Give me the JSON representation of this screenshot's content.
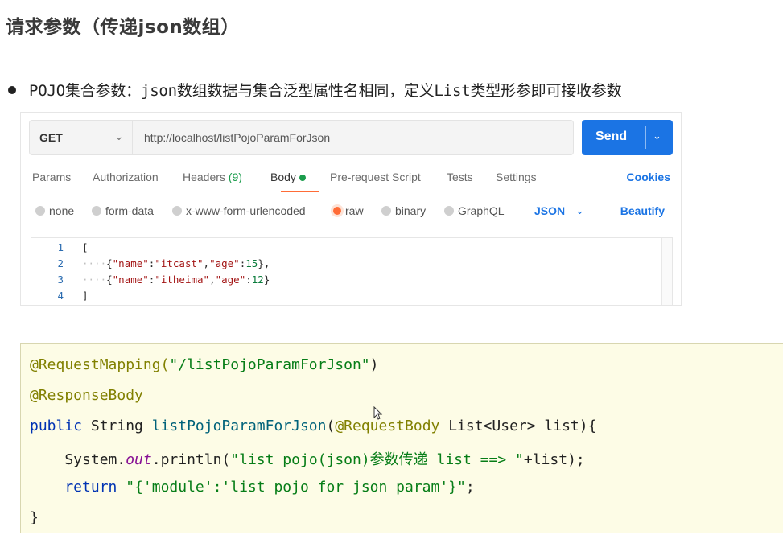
{
  "page": {
    "title": "请求参数（传递json数组）",
    "bullet": "POJO集合参数：json数组数据与集合泛型属性名相同，定义List类型形参即可接收参数"
  },
  "postman": {
    "method": "GET",
    "url": "http://localhost/listPojoParamForJson",
    "send_label": "Send",
    "tabs": [
      {
        "label": "Params"
      },
      {
        "label": "Authorization"
      },
      {
        "label": "Headers",
        "count": "(9)"
      },
      {
        "label": "Body"
      },
      {
        "label": "Pre-request Script"
      },
      {
        "label": "Tests"
      },
      {
        "label": "Settings"
      }
    ],
    "cookies_label": "Cookies",
    "body_types": [
      "none",
      "form-data",
      "x-www-form-urlencoded",
      "raw",
      "binary",
      "GraphQL"
    ],
    "selected_body_type": "raw",
    "format": "JSON",
    "beautify_label": "Beautify",
    "editor_lines": [
      {
        "n": "1",
        "text": "["
      },
      {
        "n": "2",
        "text": "····{\"name\":\"itcast\",\"age\":15},"
      },
      {
        "n": "3",
        "text": "····{\"name\":\"itheima\",\"age\":12}"
      },
      {
        "n": "4",
        "text": "]"
      }
    ],
    "colors": {
      "accent": "#1b74e4",
      "active_tab": "#ff6c37",
      "dot": "#1b9c4c"
    }
  },
  "java": {
    "line1_ann": "@RequestMapping(",
    "line1_str": "\"/listPojoParamForJson\"",
    "line1_end": ")",
    "line2": "@ResponseBody",
    "line3_kw": "public",
    "line3_type": " String ",
    "line3_fn": "listPojoParamForJson",
    "line3_open": "(",
    "line3_ann": "@RequestBody",
    "line3_rest": " List<User> list){",
    "line4_pre": "    System.",
    "line4_field": "out",
    "line4_mid": ".println(",
    "line4_str": "\"list pojo(json)参数传递 list ==> \"",
    "line4_end": "+list);",
    "line5_kw": "    return",
    "line5_sp": " ",
    "line5_str": "\"{'module':'list pojo for json param'}\"",
    "line5_end": ";",
    "line6": "}"
  }
}
